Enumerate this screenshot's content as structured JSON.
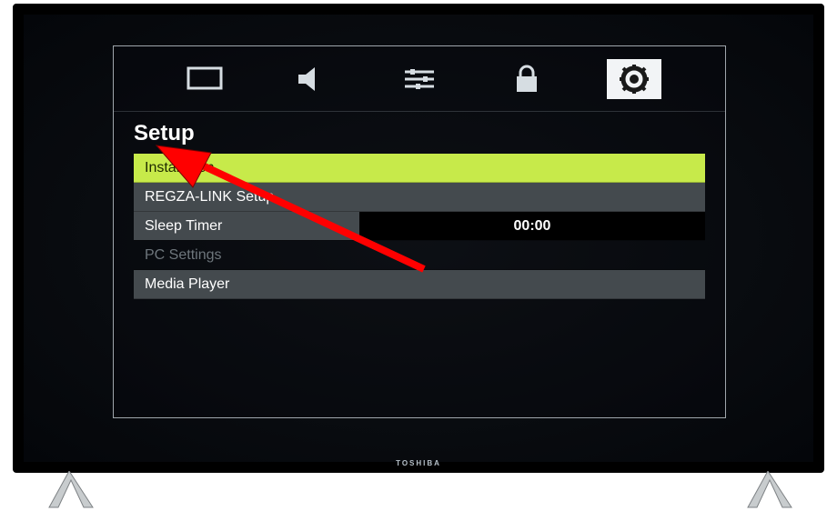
{
  "brand": "TOSHIBA",
  "tabs": {
    "picture": "picture-icon",
    "sound": "sound-icon",
    "settings": "sliders-icon",
    "lock": "lock-icon",
    "setup": "gear-icon"
  },
  "section": {
    "title": "Setup"
  },
  "menu": {
    "installation": "Installation",
    "regza": "REGZA-LINK Setup",
    "sleep_label": "Sleep Timer",
    "sleep_value": "00:00",
    "pc": "PC Settings",
    "media": "Media Player"
  },
  "annotation": {
    "arrow_color": "#ff0000"
  }
}
